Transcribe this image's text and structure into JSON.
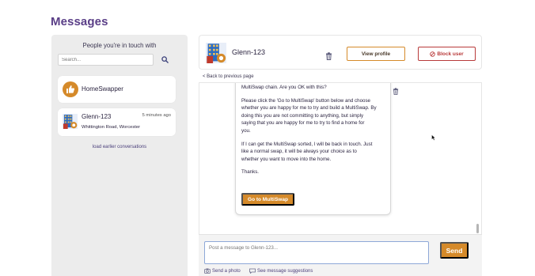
{
  "page": {
    "title": "Messages"
  },
  "left_panel": {
    "header": "People you're in touch with",
    "search_placeholder": "Search...",
    "conversations": [
      {
        "name": "HomeSwapper",
        "logo": "thumbs-up-icon"
      },
      {
        "name": "Glenn-123",
        "time": "5 minutes ago",
        "address": "Whittington Road, Worcester"
      }
    ],
    "load_earlier": "load earlier conversations"
  },
  "header": {
    "contact_name": "Glenn-123",
    "view_profile": "View profile",
    "block_user": "Block user"
  },
  "back_link": "< Back to previous page",
  "message": {
    "lines": [
      "MultiSwap chain. Are you OK with this?",
      "Please click the 'Go to MultiSwap' button below and choose",
      "whether you are happy for me to try and build a MultiSwap. By",
      "doing this you are not committing to anything, but simply",
      "saying that you are happy for me to try to find a home for",
      "you.",
      "If I can get the MultiSwap sorted, I will be back in touch. Just",
      "like a normal swap, it will be always your choice as to",
      "whether you want to move into the home.",
      "Thanks."
    ],
    "button": "Go to MultiSwap"
  },
  "compose": {
    "placeholder": "Post a message to Glenn-123...",
    "send": "Send",
    "send_photo": "Send a photo",
    "see_suggestions": "See message suggestions"
  },
  "colors": {
    "brand_purple": "#5a3e87",
    "accent_orange": "#d58a2a",
    "danger_red": "#b83a3a"
  }
}
